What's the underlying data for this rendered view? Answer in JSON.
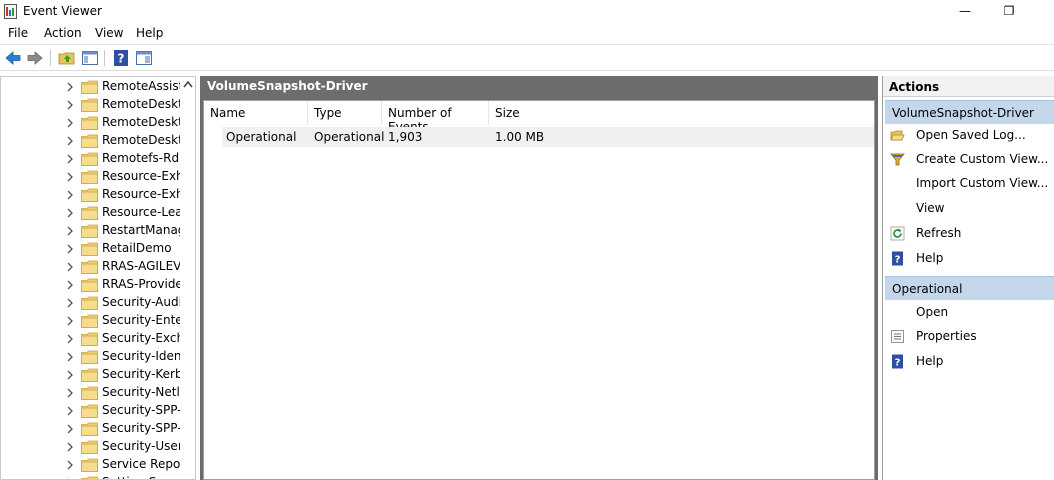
{
  "window": {
    "title": "Event Viewer",
    "minimize_glyph": "—",
    "maximize_glyph": "❐"
  },
  "menu": [
    "File",
    "Action",
    "View",
    "Help"
  ],
  "toolbar": {
    "buttons": [
      "back-icon",
      "forward-icon",
      "up-folder-icon",
      "show-hide-tree-icon",
      "help-icon",
      "show-hide-action-pane-icon"
    ]
  },
  "tree": {
    "items": [
      "RemoteAssista",
      "RemoteDeskto",
      "RemoteDeskto",
      "RemoteDeskto",
      "Remotefs-Rdb",
      "Resource-Exha",
      "Resource-Exha",
      "Resource-Leak",
      "RestartManage",
      "RetailDemo",
      "RRAS-AGILEVP",
      "RRAS-Provider",
      "Security-Audit",
      "Security-Enterp",
      "Security-Excha",
      "Security-Identi",
      "Security-Kerbe",
      "Security-Netlo",
      "Security-SPP-U",
      "Security-SPP-U",
      "Security-UserC",
      "Service Report",
      "Setting Sync"
    ]
  },
  "center": {
    "title": "VolumeSnapshot-Driver",
    "columns": [
      "Name",
      "Type",
      "Number of Events",
      "Size"
    ],
    "rows": [
      {
        "name": "Operational",
        "type": "Operational",
        "events": "1,903",
        "size": "1.00 MB"
      }
    ]
  },
  "actions": {
    "title": "Actions",
    "section1": {
      "title": "VolumeSnapshot-Driver",
      "items": [
        {
          "label": "Open Saved Log...",
          "icon": "open-folder-icon"
        },
        {
          "label": "Create Custom View...",
          "icon": "filter-icon"
        },
        {
          "label": "Import Custom View...",
          "icon": ""
        },
        {
          "label": "View",
          "icon": ""
        },
        {
          "label": "Refresh",
          "icon": "refresh-icon"
        },
        {
          "label": "Help",
          "icon": "help-icon"
        }
      ]
    },
    "section2": {
      "title": "Operational",
      "items": [
        {
          "label": "Open",
          "icon": ""
        },
        {
          "label": "Properties",
          "icon": "properties-icon"
        },
        {
          "label": "Help",
          "icon": "help-icon"
        }
      ]
    }
  },
  "colors": {
    "header_gray": "#6d6d6d",
    "section_blue": "#c4d7ea",
    "help_blue": "#2f4fa2",
    "folder_yellow": "#f0cf6a"
  }
}
